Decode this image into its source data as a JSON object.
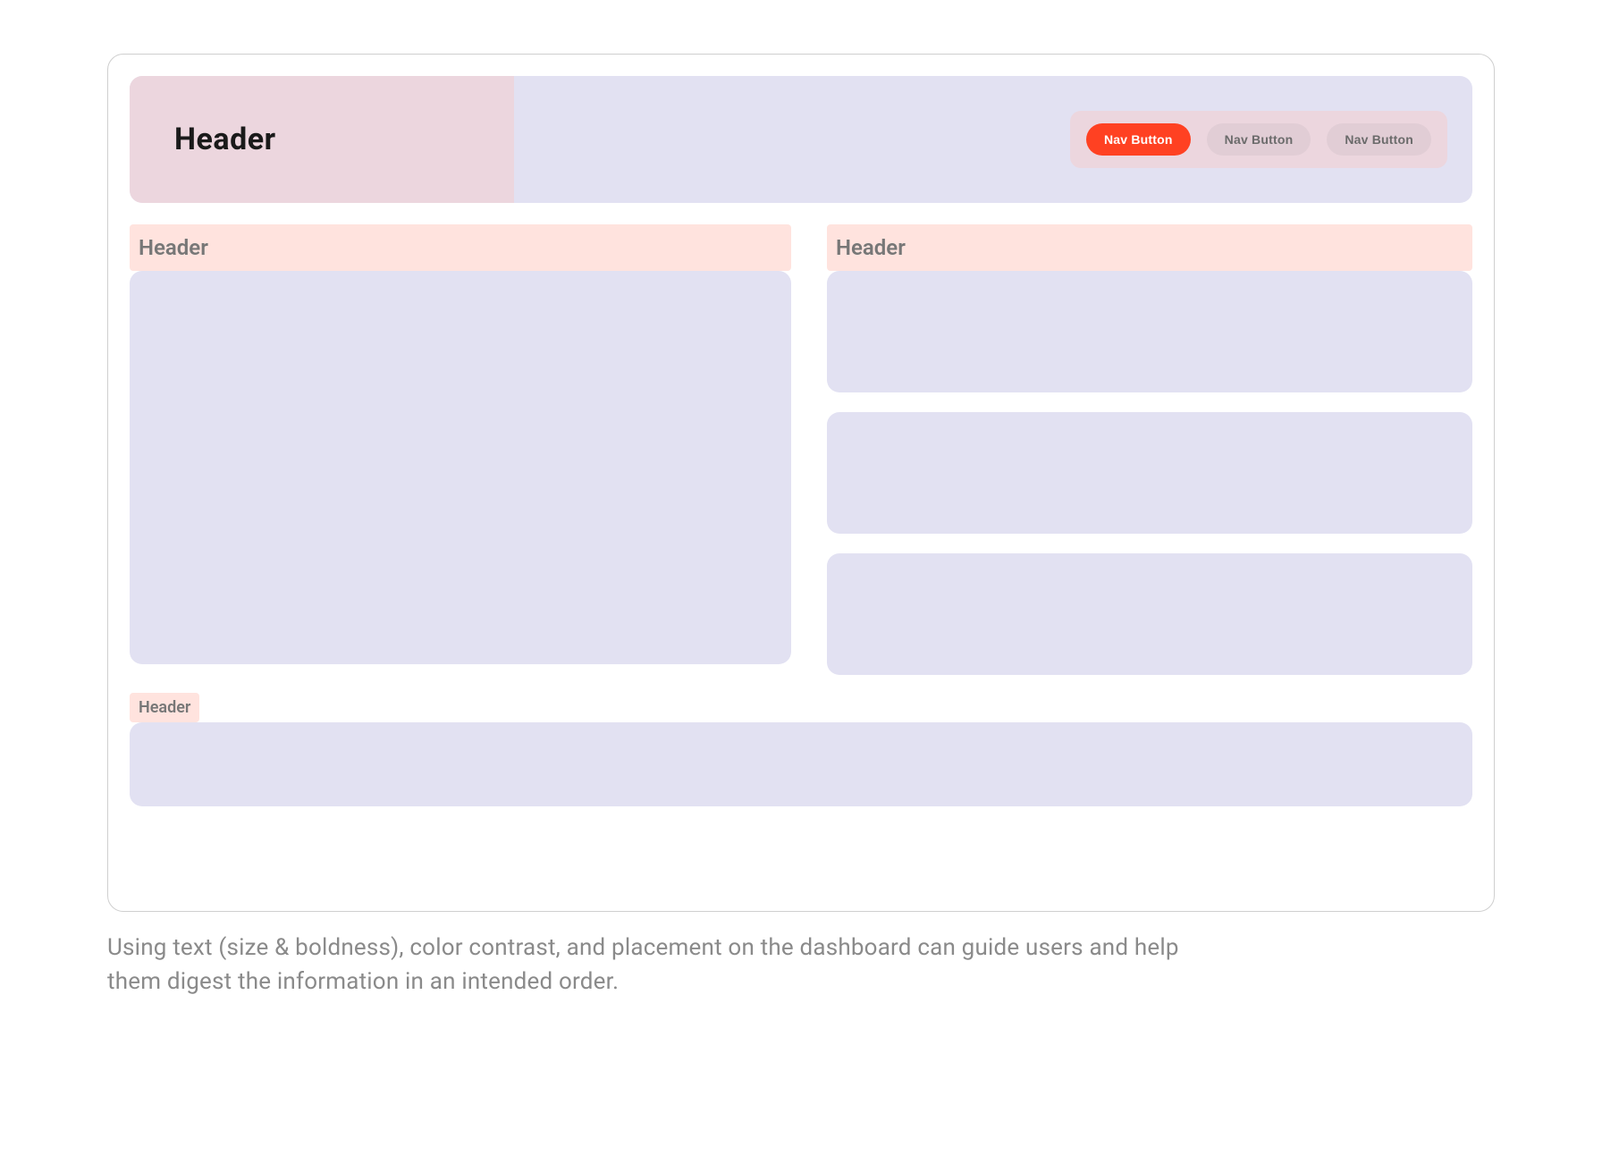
{
  "topbar": {
    "title": "Header",
    "nav": [
      {
        "label": "Nav Button",
        "active": true
      },
      {
        "label": "Nav Button",
        "active": false
      },
      {
        "label": "Nav Button",
        "active": false
      }
    ]
  },
  "sections": {
    "left_header": "Header",
    "right_header": "Header",
    "bottom_header": "Header"
  },
  "caption": "Using text (size & boldness), color contrast, and placement on the dashboard can guide users and help them digest the information in an intended order."
}
